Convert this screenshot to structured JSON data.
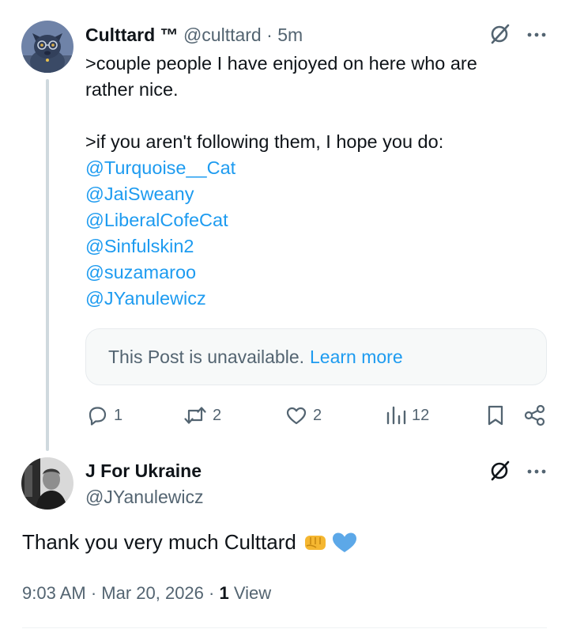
{
  "post": {
    "author_name": "Culttard ™",
    "author_handle": "@culttard",
    "separator": "·",
    "time": "5m",
    "lines": [
      ">couple people I have enjoyed on here who are",
      "rather nice.",
      "",
      ">if you aren't following them, I hope you do:"
    ],
    "mentions": [
      "@Turquoise__Cat",
      "@JaiSweany",
      "@LiberalCofeCat",
      "@Sinfulskin2",
      "@suzamaroo",
      "@JYanulewicz"
    ],
    "quote": {
      "unavailable_text": "This Post is unavailable.",
      "learn_more": "Learn more"
    },
    "actions": {
      "replies": "1",
      "reposts": "2",
      "likes": "2",
      "views": "12"
    },
    "icons": [
      "grok-slash-icon",
      "more-icon",
      "reply-icon",
      "repost-icon",
      "like-icon",
      "views-icon",
      "bookmark-icon",
      "share-icon"
    ]
  },
  "reply": {
    "author_name": "J For Ukraine",
    "author_handle": "@JYanulewicz",
    "text": "Thank you very much Culttard",
    "emojis": [
      "fist-emoji",
      "blue-heart-emoji"
    ],
    "meta_time": "9:03 AM · Mar 20, 2026 · ",
    "views_count": "1",
    "views_label": " View"
  },
  "colors": {
    "accent": "#1d9bf0",
    "muted": "#536471",
    "text": "#0f1419",
    "quote_bg": "#f7f9f9"
  }
}
